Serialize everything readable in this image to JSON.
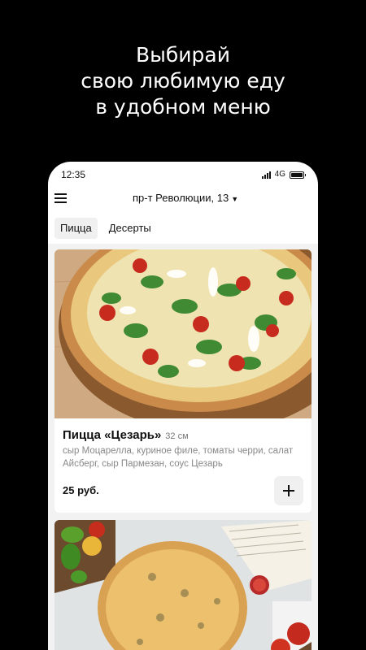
{
  "promo": {
    "line1": "Выбирай",
    "line2": "свою любимую еду",
    "line3": "в удобном меню"
  },
  "status_bar": {
    "time": "12:35",
    "network": "4G",
    "icons": [
      "signal-icon",
      "battery-icon"
    ]
  },
  "header": {
    "menu_icon": "hamburger-menu-icon",
    "address": "пр-т Революции, 13",
    "address_icon": "chevron-down-icon"
  },
  "tabs": [
    {
      "label": "Пицца",
      "active": true
    },
    {
      "label": "Десерты",
      "active": false
    }
  ],
  "products": [
    {
      "title": "Пицца «Цезарь»",
      "size": "32 см",
      "description": "сыр Моцарелла, куриное филе, томаты черри, салат Айсберг, сыр Пармезан, соус Цезарь",
      "price": "25 руб.",
      "add_icon": "plus-icon"
    }
  ],
  "colors": {
    "page_background": "#000000",
    "phone_background": "#ffffff",
    "feed_background": "#f2f2f2",
    "button_background": "#f0f0f0",
    "text_primary": "#111111",
    "text_secondary": "#888888"
  }
}
